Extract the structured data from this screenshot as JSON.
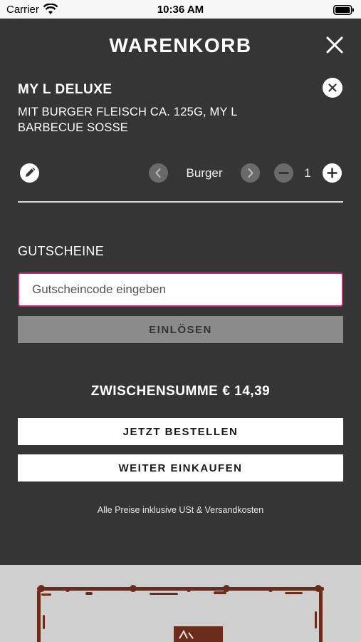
{
  "status_bar": {
    "carrier": "Carrier",
    "time": "10:36 AM"
  },
  "header": {
    "title": "WARENKORB"
  },
  "cart_item": {
    "name": "MY L DELUXE",
    "description": "MIT BURGER FLEISCH CA. 125G, MY L BARBECUE SOSSE",
    "variant": "Burger",
    "quantity": "1"
  },
  "coupon": {
    "heading": "GUTSCHEINE",
    "placeholder": "Gutscheincode eingeben",
    "value": "",
    "redeem_label": "EINLÖSEN"
  },
  "summary": {
    "subtotal_label": "ZWISCHENSUMME",
    "subtotal_value": "€ 14,39"
  },
  "actions": {
    "checkout_label": "JETZT BESTELLEN",
    "continue_label": "WEITER EINKAUFEN"
  },
  "footer_note": "Alle Preise inklusive USt & Versandkosten",
  "colors": {
    "panel": "#353535",
    "accent_border": "#c0307a",
    "logo_brown": "#6b2c1c",
    "stamp_bg": "#cfcfcf"
  },
  "icons": [
    "wifi-icon",
    "battery-icon",
    "close-icon",
    "item-remove-icon",
    "edit-icon",
    "chevron-left-icon",
    "chevron-right-icon",
    "minus-icon",
    "plus-icon"
  ]
}
